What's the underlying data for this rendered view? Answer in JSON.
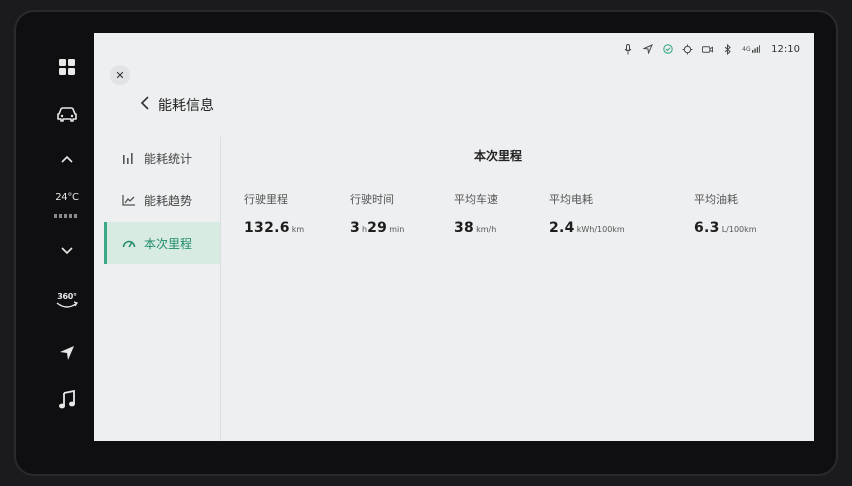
{
  "status_bar": {
    "time": "12:10",
    "network": "4G"
  },
  "dock": {
    "temperature": "24°C",
    "view_360_label": "360°"
  },
  "header": {
    "title": "能耗信息"
  },
  "sidebar": {
    "items": [
      {
        "label": "能耗统计",
        "active": false
      },
      {
        "label": "能耗趋势",
        "active": false
      },
      {
        "label": "本次里程",
        "active": true
      }
    ]
  },
  "main": {
    "title": "本次里程",
    "metrics": [
      {
        "label": "行驶里程",
        "value": "132.6",
        "unit": "km"
      },
      {
        "label": "行驶时间",
        "hours": "3",
        "hours_unit": "h",
        "minutes": "29",
        "minutes_unit": "min"
      },
      {
        "label": "平均车速",
        "value": "38",
        "unit": "km/h"
      },
      {
        "label": "平均电耗",
        "value": "2.4",
        "unit": "kWh/100km"
      },
      {
        "label": "平均油耗",
        "value": "6.3",
        "unit": "L/100km"
      }
    ]
  },
  "colors": {
    "accent": "#3aa986",
    "active_bg": "#d7ebe3",
    "screen_bg": "#eeeff0"
  }
}
